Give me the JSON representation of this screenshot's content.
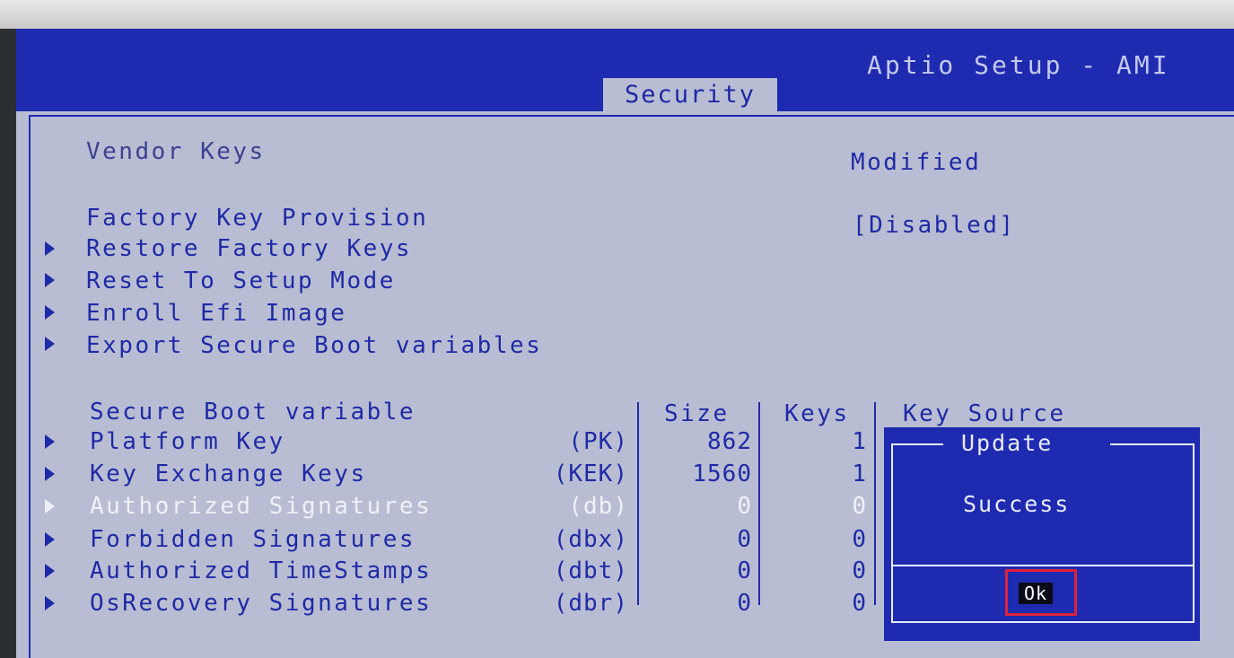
{
  "header": {
    "title": "Aptio Setup - AMI",
    "active_tab": "Security"
  },
  "colors": {
    "header_bg": "#1e2ab0",
    "panel_bg": "#b9bdd3",
    "text": "#1f2aa6",
    "dialog_bg": "#1e2ab0",
    "highlight_border": "#e0213a"
  },
  "settings": {
    "vendor_keys_label": "Vendor Keys",
    "vendor_keys_value": "Modified",
    "factory_key_label": "Factory Key Provision",
    "factory_key_value": "[Disabled]",
    "actions": [
      "Restore Factory Keys",
      "Reset To Setup Mode",
      "Enroll Efi Image",
      "Export Secure Boot variables"
    ]
  },
  "variables_table": {
    "columns": [
      "Secure Boot variable",
      "Size",
      "Keys",
      "Key Source"
    ],
    "rows": [
      {
        "name": "Platform Key",
        "short": "(PK)",
        "size": "862",
        "keys": "1"
      },
      {
        "name": "Key Exchange Keys",
        "short": "(KEK)",
        "size": "1560",
        "keys": "1"
      },
      {
        "name": "Authorized Signatures",
        "short": "(db)",
        "size": "0",
        "keys": "0"
      },
      {
        "name": "Forbidden  Signatures",
        "short": "(dbx)",
        "size": "0",
        "keys": "0"
      },
      {
        "name": "Authorized TimeStamps",
        "short": "(dbt)",
        "size": "0",
        "keys": "0"
      },
      {
        "name": "OsRecovery Signatures",
        "short": "(dbr)",
        "size": "0",
        "keys": "0"
      }
    ]
  },
  "dialog": {
    "title": "Update",
    "message": "Success",
    "ok_label": "Ok"
  }
}
